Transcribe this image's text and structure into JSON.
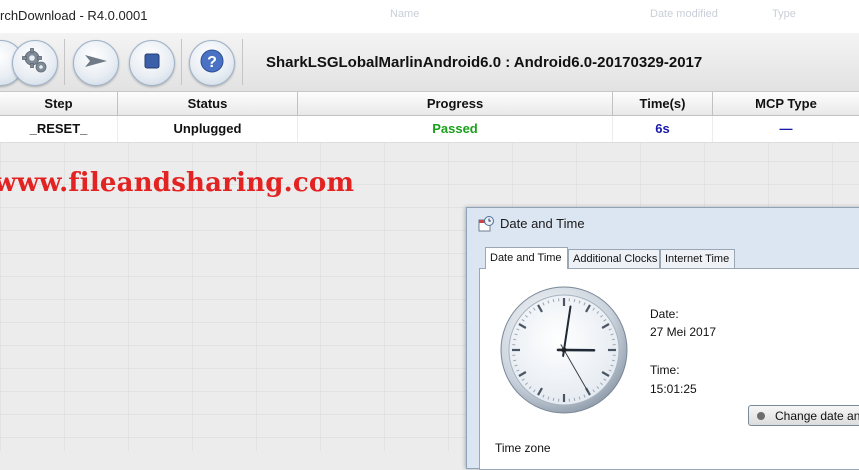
{
  "window": {
    "title": "rchDownload - R4.0.0001",
    "ghost_headers": [
      "Name",
      "Date modified",
      "Type"
    ]
  },
  "toolbar": {
    "build_label": "SharkLSGLobalMarlinAndroid6.0 : Android6.0-20170329-2017",
    "buttons": [
      {
        "name": "settings",
        "icon": "gear-icon"
      },
      {
        "name": "start",
        "icon": "play-arrow-icon"
      },
      {
        "name": "stop",
        "icon": "stop-square-icon"
      },
      {
        "name": "help",
        "icon": "question-icon"
      }
    ]
  },
  "table": {
    "headers": [
      "Step",
      "Status",
      "Progress",
      "Time(s)",
      "MCP Type"
    ],
    "rows": [
      {
        "step": "_RESET_",
        "status": "Unplugged",
        "progress": "Passed",
        "time": "6s",
        "mcp": "—"
      }
    ]
  },
  "watermark": "www.fileandsharing.com",
  "dialog": {
    "title": "Date and Time",
    "tabs": [
      "Date and Time",
      "Additional Clocks",
      "Internet Time"
    ],
    "date_label": "Date:",
    "date_value": "27 Mei 2017",
    "time_label": "Time:",
    "time_value": "15:01:25",
    "change_button": "Change date and t",
    "timezone_label": "Time zone"
  },
  "colors": {
    "passed": "#1aa01a",
    "time": "#1a1aa8",
    "watermark": "#e32222"
  }
}
